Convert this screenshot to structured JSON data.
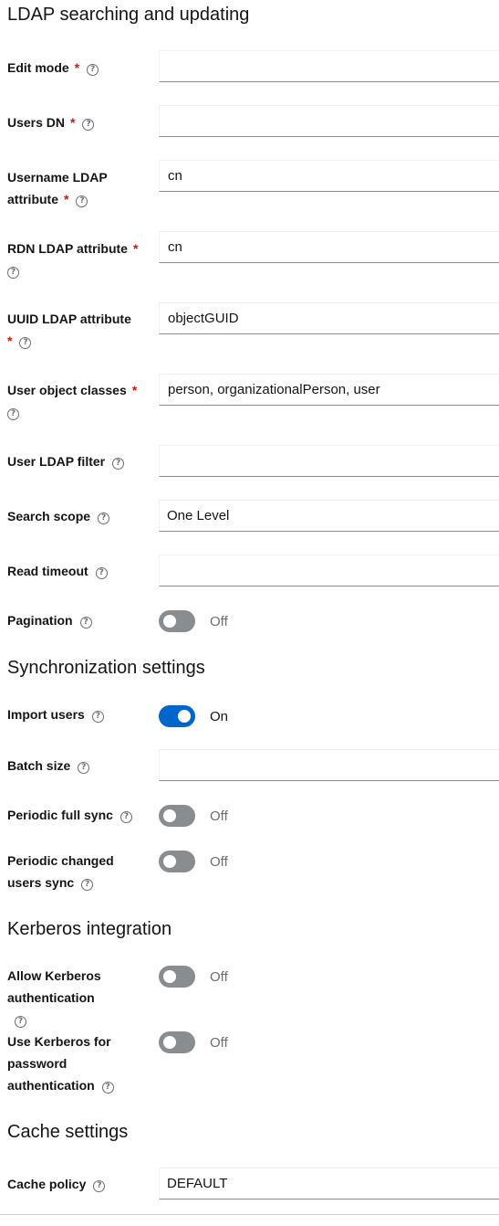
{
  "sections": {
    "ldap_search": "LDAP searching and updating",
    "sync": "Synchronization settings",
    "kerberos": "Kerberos integration",
    "cache": "Cache settings"
  },
  "help_glyph": "?",
  "required_mark": "*",
  "fields": {
    "edit_mode": {
      "label": "Edit mode",
      "value": ""
    },
    "users_dn": {
      "label": "Users DN",
      "value": ""
    },
    "username_ldap_attr": {
      "label": "Username LDAP attribute",
      "value": "cn"
    },
    "rdn_ldap_attr": {
      "label": "RDN LDAP attribute",
      "value": "cn"
    },
    "uuid_ldap_attr": {
      "label": "UUID LDAP attribute",
      "value": "objectGUID"
    },
    "user_object_classes": {
      "label": "User object classes",
      "value": "person, organizationalPerson, user"
    },
    "user_ldap_filter": {
      "label": "User LDAP filter",
      "value": ""
    },
    "search_scope": {
      "label": "Search scope",
      "value": "One Level"
    },
    "read_timeout": {
      "label": "Read timeout",
      "value": ""
    },
    "batch_size": {
      "label": "Batch size",
      "value": ""
    },
    "cache_policy": {
      "label": "Cache policy",
      "value": "DEFAULT"
    }
  },
  "toggles": {
    "pagination": {
      "label": "Pagination",
      "state": "Off"
    },
    "import_users": {
      "label": "Import users",
      "state": "On"
    },
    "periodic_full_sync": {
      "label": "Periodic full sync",
      "state": "Off"
    },
    "periodic_changed_sync": {
      "label": "Periodic changed users sync",
      "state": "Off"
    },
    "allow_kerberos": {
      "label": "Allow Kerberos authentication",
      "state": "Off"
    },
    "use_kerberos_password": {
      "label": "Use Kerberos for password authentication",
      "state": "Off"
    }
  },
  "colors": {
    "required": "#c9190b",
    "switch_on": "#0066cc",
    "switch_off": "#8a8d90"
  }
}
